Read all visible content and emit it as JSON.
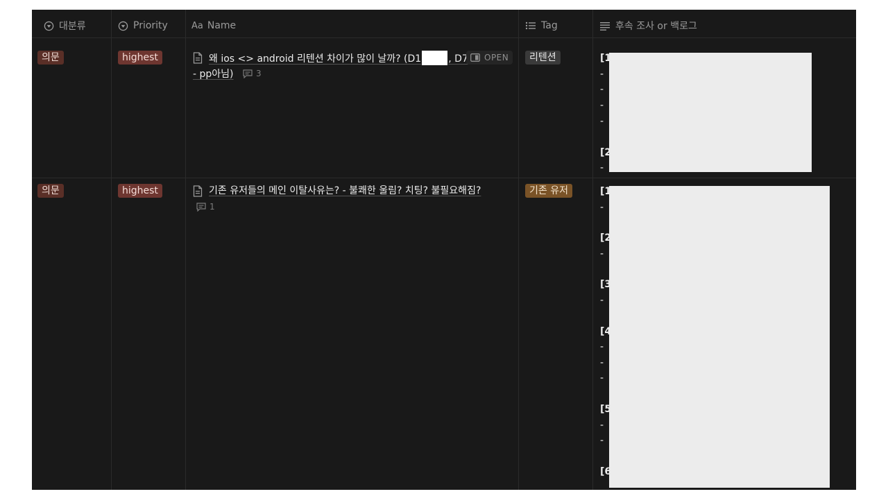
{
  "columns": {
    "category": "대분류",
    "priority": "Priority",
    "name_prefix": "Aa",
    "name": "Name",
    "tag": "Tag",
    "backlog": "후속 조사 or 백로그"
  },
  "rows": [
    {
      "category": "의문",
      "priority": "highest",
      "title_part1": "왜 ios <> android 리텐션 차이가 많이 날까? (D1",
      "title_part2": ", D7",
      "title_line2": "- pp아님)",
      "open_label": "OPEN",
      "comments": "3",
      "tag": "리텐션",
      "backlog": [
        "[1",
        "- ",
        "- ",
        "- ",
        "- ",
        "[2",
        "- "
      ]
    },
    {
      "category": "의문",
      "priority": "highest",
      "title": "기존 유저들의 메인 이탈사유는? - 불쾌한 울림? 치팅? 불필요해짐?",
      "comments": "1",
      "tag": "기존 유저",
      "backlog": [
        "[1",
        "- ",
        "[2",
        "- ",
        "[3",
        "- ",
        "[4",
        "- ",
        "- ",
        "- ",
        "[5",
        "- ",
        "- ",
        "[6"
      ]
    }
  ],
  "colors": {
    "background": "#191919",
    "tag_category": "#5a2f27",
    "tag_priority": "#6e3630",
    "tag_retention": "#3a3a3a",
    "tag_existing_user": "#7a5327"
  }
}
